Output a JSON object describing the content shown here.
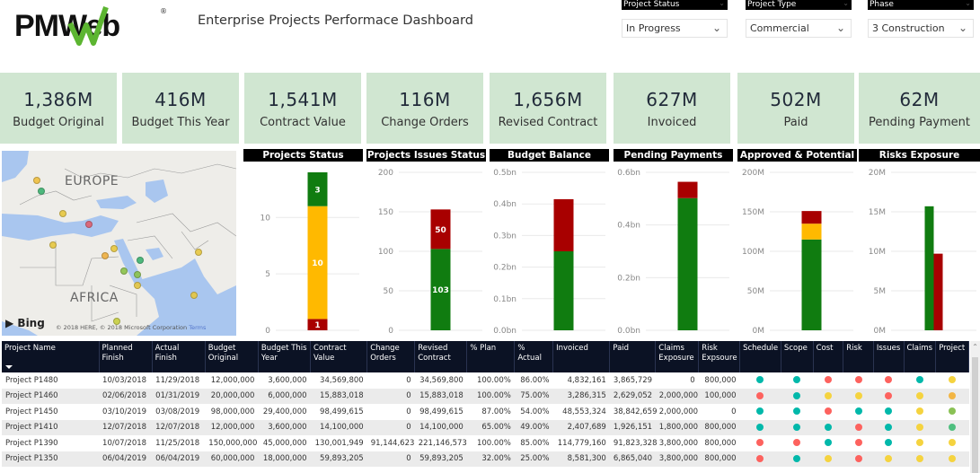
{
  "header": {
    "logo_text": "PMWeb",
    "logo_reg": "®",
    "title": "Enterprise Projects Performace Dashboard"
  },
  "slicers": [
    {
      "label": "Project Status",
      "value": "In Progress"
    },
    {
      "label": "Project Type",
      "value": "Commercial"
    },
    {
      "label": "Phase",
      "value": "3 Construction"
    }
  ],
  "kpis": [
    {
      "value": "1,386M",
      "label": "Budget Original"
    },
    {
      "value": "416M",
      "label": "Budget This Year"
    },
    {
      "value": "1,541M",
      "label": "Contract Value"
    },
    {
      "value": "116M",
      "label": "Change Orders"
    },
    {
      "value": "1,656M",
      "label": "Revised Contract"
    },
    {
      "value": "627M",
      "label": "Invoiced"
    },
    {
      "value": "502M",
      "label": "Paid"
    },
    {
      "value": "62M",
      "label": "Pending Payment"
    }
  ],
  "map": {
    "labels": [
      "EUROPE",
      "AFRICA"
    ],
    "bing": "Bing",
    "copyright": "© 2018 HERE, © 2018 Microsoft Corporation",
    "terms": "Terms",
    "points": [
      {
        "x": 0.15,
        "y": 0.16,
        "color": "#f0c040"
      },
      {
        "x": 0.17,
        "y": 0.22,
        "color": "#3cb371"
      },
      {
        "x": 0.26,
        "y": 0.34,
        "color": "#e8c840"
      },
      {
        "x": 0.37,
        "y": 0.4,
        "color": "#e06070"
      },
      {
        "x": 0.22,
        "y": 0.51,
        "color": "#e8c840"
      },
      {
        "x": 0.44,
        "y": 0.57,
        "color": "#f0b040"
      },
      {
        "x": 0.48,
        "y": 0.53,
        "color": "#e8c840"
      },
      {
        "x": 0.59,
        "y": 0.59,
        "color": "#3cb371"
      },
      {
        "x": 0.52,
        "y": 0.65,
        "color": "#8bc34a"
      },
      {
        "x": 0.58,
        "y": 0.67,
        "color": "#8bc34a"
      },
      {
        "x": 0.58,
        "y": 0.73,
        "color": "#e8c840"
      },
      {
        "x": 0.84,
        "y": 0.55,
        "color": "#e8c840"
      },
      {
        "x": 0.82,
        "y": 0.78,
        "color": "#e8c840"
      },
      {
        "x": 0.49,
        "y": 0.92,
        "color": "#c8d040"
      }
    ]
  },
  "chart_data": [
    {
      "type": "bar",
      "title": "Projects Status",
      "stacked": true,
      "categories": [
        ""
      ],
      "series": [
        {
          "name": "Red",
          "values": [
            1
          ],
          "color": "#a80000",
          "label": "1"
        },
        {
          "name": "Yellow",
          "values": [
            10
          ],
          "color": "#ffb900",
          "label": "10"
        },
        {
          "name": "Green",
          "values": [
            3
          ],
          "color": "#107c10",
          "label": "3"
        }
      ],
      "ylim": [
        0,
        14
      ],
      "yticks": [
        0,
        5,
        10
      ],
      "ytick_labels": [
        "0",
        "5",
        "10"
      ],
      "grid": true
    },
    {
      "type": "bar",
      "title": "Projects Issues Status",
      "stacked": true,
      "categories": [
        ""
      ],
      "series": [
        {
          "name": "Green",
          "values": [
            103
          ],
          "color": "#107c10",
          "label": "103"
        },
        {
          "name": "Red",
          "values": [
            50
          ],
          "color": "#a80000",
          "label": "50"
        }
      ],
      "ylim": [
        0,
        200
      ],
      "yticks": [
        0,
        50,
        100,
        150,
        200
      ],
      "ytick_labels": [
        "0",
        "50",
        "100",
        "150",
        "200"
      ],
      "grid": true
    },
    {
      "type": "bar",
      "title": "Budget Balance",
      "stacked": true,
      "categories": [
        ""
      ],
      "series": [
        {
          "name": "Green",
          "values": [
            0.25
          ],
          "color": "#107c10"
        },
        {
          "name": "Red",
          "values": [
            0.165
          ],
          "color": "#a80000"
        }
      ],
      "ylim": [
        0,
        0.5
      ],
      "yticks": [
        0,
        0.1,
        0.2,
        0.3,
        0.4,
        0.5
      ],
      "ytick_labels": [
        "0.0bn",
        "0.1bn",
        "0.2bn",
        "0.3bn",
        "0.4bn",
        "0.5bn"
      ],
      "grid": true
    },
    {
      "type": "bar",
      "title": "Pending Payments",
      "stacked": true,
      "categories": [
        ""
      ],
      "series": [
        {
          "name": "Green",
          "values": [
            0.502
          ],
          "color": "#107c10"
        },
        {
          "name": "Red",
          "values": [
            0.062
          ],
          "color": "#a80000"
        }
      ],
      "ylim": [
        0,
        0.6
      ],
      "yticks": [
        0,
        0.2,
        0.4,
        0.6
      ],
      "ytick_labels": [
        "0.0bn",
        "0.2bn",
        "0.4bn",
        "0.6bn"
      ],
      "grid": true
    },
    {
      "type": "bar",
      "title": "Approved & Potential",
      "stacked": true,
      "categories": [
        ""
      ],
      "series": [
        {
          "name": "Green",
          "values": [
            115
          ],
          "color": "#107c10"
        },
        {
          "name": "Yellow",
          "values": [
            20
          ],
          "color": "#ffb900"
        },
        {
          "name": "Red",
          "values": [
            16
          ],
          "color": "#a80000"
        }
      ],
      "ylim": [
        0,
        200
      ],
      "yticks": [
        0,
        50,
        100,
        150,
        200
      ],
      "ytick_labels": [
        "0M",
        "50M",
        "100M",
        "150M",
        "200M"
      ],
      "grid": true
    },
    {
      "type": "bar",
      "title": "Risks Exposure",
      "stacked": false,
      "categories": [
        ""
      ],
      "series": [
        {
          "name": "Green",
          "values": [
            15.7
          ],
          "color": "#107c10"
        },
        {
          "name": "Red",
          "values": [
            9.7
          ],
          "color": "#a80000"
        }
      ],
      "ylim": [
        0,
        20
      ],
      "yticks": [
        0,
        5,
        10,
        15,
        20
      ],
      "ytick_labels": [
        "0M",
        "5M",
        "10M",
        "15M",
        "20M"
      ],
      "grid": true
    }
  ],
  "table": {
    "columns": [
      "Project Name",
      "Planned Finish",
      "Actual Finish",
      "Budget Original",
      "Budget This Year",
      "Contract Value",
      "Change Orders",
      "Revised Contract",
      "% Plan",
      "% Actual",
      "Invoiced",
      "Paid",
      "Claims Exposure",
      "Risk Expsoure",
      "Schedule",
      "Scope",
      "Cost",
      "Risk",
      "Issues",
      "Claims",
      "Project"
    ],
    "rows": [
      {
        "cells": [
          "Project P1480",
          "10/03/2018",
          "11/29/2018",
          "12,000,000",
          "3,600,000",
          "34,569,800",
          "0",
          "34,569,800",
          "100.00%",
          "86.00%",
          "4,832,161",
          "3,865,729",
          "0",
          "800,000"
        ],
        "status": [
          "teal",
          "teal",
          "red",
          "red",
          "red",
          "teal",
          "yellow"
        ]
      },
      {
        "cells": [
          "Project P1460",
          "02/06/2018",
          "01/31/2019",
          "20,000,000",
          "6,000,000",
          "15,883,018",
          "0",
          "15,883,018",
          "100.00%",
          "75.00%",
          "3,286,315",
          "2,629,052",
          "2,000,000",
          "100,000"
        ],
        "status": [
          "red",
          "teal",
          "yellow",
          "yellow",
          "red",
          "yellow",
          "orange"
        ]
      },
      {
        "cells": [
          "Project P1450",
          "03/10/2019",
          "03/08/2019",
          "98,000,000",
          "29,400,000",
          "98,499,615",
          "0",
          "98,499,615",
          "87.00%",
          "54.00%",
          "48,553,324",
          "38,842,659",
          "2,000,000",
          "0"
        ],
        "status": [
          "teal",
          "teal",
          "red",
          "teal",
          "teal",
          "yellow",
          "lightgreen"
        ]
      },
      {
        "cells": [
          "Project P1410",
          "12/07/2018",
          "12/07/2018",
          "12,000,000",
          "3,600,000",
          "14,100,000",
          "0",
          "14,100,000",
          "65.00%",
          "49.00%",
          "2,407,689",
          "1,926,151",
          "1,800,000",
          "800,000"
        ],
        "status": [
          "teal",
          "teal",
          "teal",
          "red",
          "teal",
          "yellow",
          "green"
        ]
      },
      {
        "cells": [
          "Project P1390",
          "10/07/2018",
          "11/25/2018",
          "150,000,000",
          "45,000,000",
          "130,001,949",
          "91,144,623",
          "221,146,573",
          "100.00%",
          "85.00%",
          "114,779,160",
          "91,823,328",
          "3,800,000",
          "800,000"
        ],
        "status": [
          "red",
          "red",
          "teal",
          "red",
          "teal",
          "yellow",
          "yellow"
        ]
      },
      {
        "cells": [
          "Project P1350",
          "06/04/2019",
          "06/04/2019",
          "60,000,000",
          "18,000,000",
          "59,893,205",
          "0",
          "59,893,205",
          "32.00%",
          "25.00%",
          "8,581,300",
          "6,865,040",
          "3,800,000",
          "800,000"
        ],
        "status": [
          "red",
          "teal",
          "yellow",
          "red",
          "yellow",
          "yellow",
          "yellow"
        ]
      }
    ]
  },
  "status_colors": {
    "teal": "#01b8aa",
    "red": "#fd625e",
    "yellow": "#f5d33f",
    "orange": "#f2b544",
    "lightgreen": "#8ac155",
    "green": "#4fbf7f"
  }
}
